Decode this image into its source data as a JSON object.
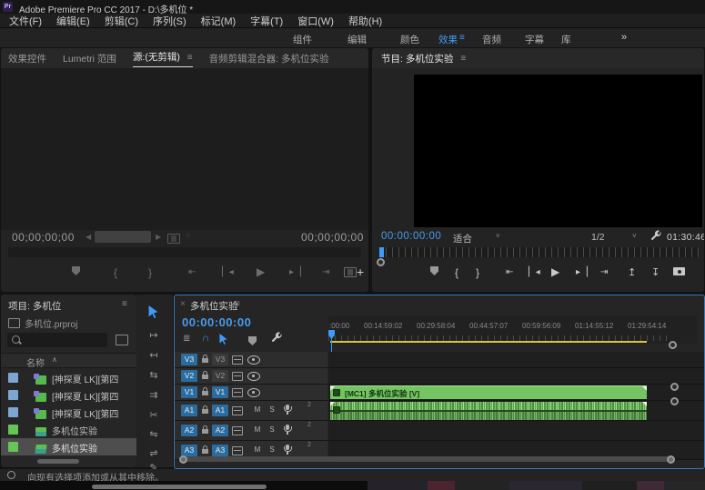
{
  "colors": {
    "accent_blue": "#3f9bfa",
    "timecode_blue": "#4a9aef",
    "clip_green": "#74c464",
    "label_blue": "#7da6d4",
    "label_green": "#66c554",
    "work_area_yellow": "#d9c63c",
    "track_target_blue": "#2b6b9d"
  },
  "titlebar": {
    "app_icon": "Pr",
    "title": "Adobe Premiere Pro CC 2017 - D:\\多机位 *"
  },
  "menubar": {
    "items": [
      "文件(F)",
      "编辑(E)",
      "剪辑(C)",
      "序列(S)",
      "标记(M)",
      "字幕(T)",
      "窗口(W)",
      "帮助(H)"
    ]
  },
  "workspace_bar": {
    "tabs": [
      "组件",
      "编辑",
      "颜色",
      "效果",
      "音频",
      "字幕",
      "库"
    ],
    "active_tab": "效果",
    "menu_glyph": "≡",
    "overflow_glyph": "»"
  },
  "icons": {
    "menu": "≡",
    "chevron": "˅",
    "close": "×",
    "sort": "∧",
    "plus": "+",
    "snap": "∩",
    "nest": "≣",
    "prev": "◀",
    "next": "▶"
  },
  "transport_glyphs": {
    "in_point": "{",
    "out_point": "}",
    "goto_in": "⇤",
    "step_back": "▏◂",
    "play": "▶",
    "step_fwd": "▸▕",
    "goto_out": "⇥",
    "lift": "↥",
    "extract": "↧"
  },
  "tool_glyphs": {
    "track_select": "↦",
    "ripple_edit": "↤",
    "rolling_edit": "⇆",
    "rate_stretch": "⇉",
    "razor": "✂",
    "slip": "⇋",
    "slide": "⇌",
    "pen": "✎"
  },
  "source_monitor": {
    "tabs": [
      "效果控件",
      "Lumetri 范围",
      "源:(无剪辑)",
      "音频剪辑混合器: 多机位实验"
    ],
    "active_tab": "源:(无剪辑)",
    "timecode_left": "00;00;00;00",
    "timecode_right": "00;00;00;00"
  },
  "program_monitor": {
    "tab": "节目: 多机位实验",
    "timecode": "00:00:00:00",
    "zoom_select": "适合",
    "resolution_select": "1/2",
    "duration": "01:30:46"
  },
  "project_panel": {
    "title": "项目: 多机位",
    "project_file": "多机位.prproj",
    "name_column": "名称",
    "items": [
      {
        "name": "[神探夏 LK][第四"
      },
      {
        "name": "[神探夏 LK][第四"
      },
      {
        "name": "[神探夏 LK][第四"
      },
      {
        "name": "多机位实验"
      },
      {
        "name": "多机位实验"
      }
    ]
  },
  "timeline": {
    "tab": "多机位实验",
    "timecode": "00:00:00:00",
    "ruler_labels": [
      ":00:00",
      "00:14:59:02",
      "00:29:58:04",
      "00:44:57:07",
      "00:59:56:09",
      "01:14:55:12",
      "01:29:54:14"
    ],
    "video_tracks": [
      {
        "badge": "V3",
        "assign": "V3"
      },
      {
        "badge": "V2",
        "assign": "V2"
      },
      {
        "badge": "V1",
        "assign": "V1"
      }
    ],
    "audio_tracks": [
      {
        "badge": "A1",
        "assign": "A1",
        "mute": "M",
        "solo": "S",
        "meta": "2"
      },
      {
        "badge": "A2",
        "assign": "A2",
        "mute": "M",
        "solo": "S",
        "meta": "2"
      },
      {
        "badge": "A3",
        "assign": "A3",
        "mute": "M",
        "solo": "S",
        "meta": "2"
      }
    ],
    "video_clip_label": "[MC1] 多机位实验 [V]"
  },
  "status_bar": {
    "message": "向现有选择项添加或从其中移除。"
  }
}
